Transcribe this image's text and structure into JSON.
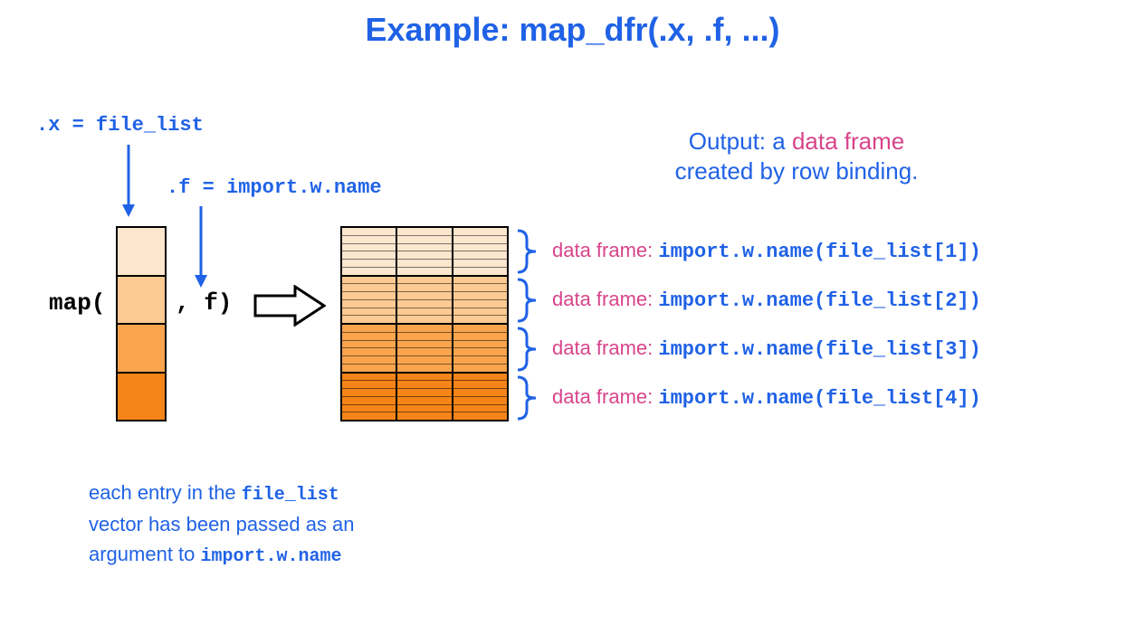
{
  "title": "Example: map_dfr(.x, .f, ...)",
  "labels": {
    "x": ".x = file_list",
    "f": ".f = import.w.name"
  },
  "map_call": {
    "pre": "map(",
    "post": ", f)"
  },
  "output_header": {
    "line1_a": "Output: a ",
    "line1_b": "data frame",
    "line2": "created by row binding."
  },
  "rows": [
    {
      "label": "data frame:",
      "call": "import.w.name(file_list[1])"
    },
    {
      "label": "data frame:",
      "call": "import.w.name(file_list[2])"
    },
    {
      "label": "data frame:",
      "call": "import.w.name(file_list[3])"
    },
    {
      "label": "data frame:",
      "call": "import.w.name(file_list[4])"
    }
  ],
  "note": {
    "t1": "each entry in the ",
    "c1": "file_list",
    "t2": "vector has been passed as an",
    "t3": "argument to ",
    "c2": "import.w.name"
  },
  "colors": {
    "blue": "#2062e6",
    "pink": "#d8448a",
    "shades": [
      "#fde6ce",
      "#fcca92",
      "#faa44e",
      "#f58518"
    ]
  }
}
